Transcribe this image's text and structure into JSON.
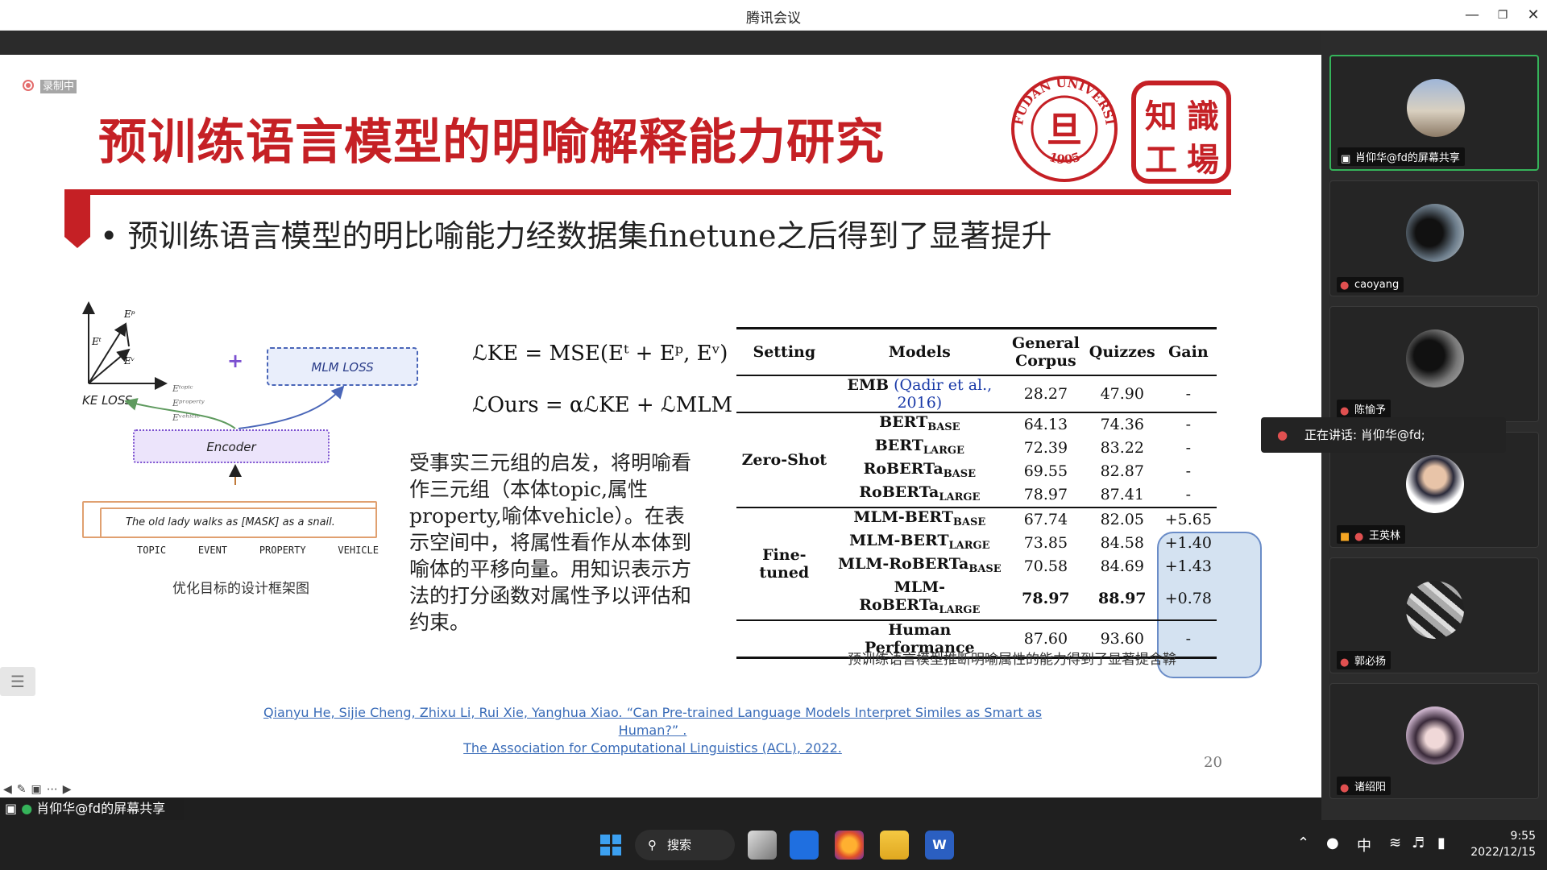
{
  "window": {
    "title": "腾讯会议"
  },
  "recording": {
    "label": "录制中"
  },
  "slide": {
    "title": "预训练语言模型的明喻解释能力研究",
    "bullet": "预训练语言模型的明比喻能力经数据集finetune之后得到了显著提升",
    "logo_fudan": {
      "top": "FUDAN UNIVERSITY",
      "year": "1905"
    },
    "logo_zhishi": [
      "知",
      "識",
      "工",
      "場"
    ],
    "diagram": {
      "ep": "Eᵖ",
      "et": "Eᵗ",
      "ev": "Eᵛ",
      "ke_loss": "KE LOSS",
      "mlm_loss": "MLM LOSS",
      "plus": "+",
      "e_topic": "Eᵗᵒᵖⁱᶜ",
      "e_property": "Eᵖʳᵒᵖᵉʳᵗʸ",
      "e_vehicle": "Eᵛᵉʰⁱᶜˡᵉ",
      "encoder": "Encoder",
      "sentence": "The old lady walks as [MASK] as a snail.",
      "labels": [
        "TOPIC",
        "EVENT",
        "PROPERTY",
        "VEHICLE"
      ]
    },
    "caption_left": "优化目标的设计框架图",
    "formula1": "ℒKE = MSE(Eᵗ + Eᵖ, Eᵛ)",
    "formula2": "ℒOurs = αℒKE + ℒMLM",
    "paragraph": "受事实三元组的启发，将明喻看作三元组（本体topic,属性property,喻体vehicle）。在表示空间中，将属性看作从本体到喻体的平移向量。用知识表示方法的打分函数对属性予以评估和约束。",
    "table": {
      "headers": [
        "Setting",
        "Models",
        "General Corpus",
        "Quizzes",
        "Gain"
      ],
      "emb": {
        "model": "EMB",
        "cite": "(Qadir et al., 2016)",
        "general": "28.27",
        "quizzes": "47.90",
        "gain": "-"
      },
      "zero_shot": {
        "label": "Zero-Shot",
        "rows": [
          {
            "model": "BERT",
            "sub": "BASE",
            "general": "64.13",
            "quizzes": "74.36",
            "gain": "-"
          },
          {
            "model": "BERT",
            "sub": "LARGE",
            "general": "72.39",
            "quizzes": "83.22",
            "gain": "-"
          },
          {
            "model": "RoBERTa",
            "sub": "BASE",
            "general": "69.55",
            "quizzes": "82.87",
            "gain": "-"
          },
          {
            "model": "RoBERTa",
            "sub": "LARGE",
            "general": "78.97",
            "quizzes": "87.41",
            "gain": "-"
          }
        ]
      },
      "fine_tuned": {
        "label": "Fine-tuned",
        "rows": [
          {
            "model": "MLM-BERT",
            "sub": "BASE",
            "general": "67.74",
            "quizzes": "82.05",
            "gain": "+5.65"
          },
          {
            "model": "MLM-BERT",
            "sub": "LARGE",
            "general": "73.85",
            "quizzes": "84.58",
            "gain": "+1.40"
          },
          {
            "model": "MLM-RoBERTa",
            "sub": "BASE",
            "general": "70.58",
            "quizzes": "84.69",
            "gain": "+1.43"
          },
          {
            "model": "MLM-RoBERTa",
            "sub": "LARGE",
            "general": "78.97",
            "quizzes": "88.97",
            "gain": "+0.78"
          }
        ]
      },
      "human": {
        "model": "Human Performance",
        "general": "87.60",
        "quizzes": "93.60",
        "gain": "-"
      }
    },
    "caption_right": "预训练语言模型推断明喻属性的能力得到了显著提舍鞥",
    "reference_line1": "Qianyu He, Sijie Cheng, Zhixu Li, Rui Xie, Yanghua Xiao. “Can Pre-trained Language Models Interpret Similes as Smart as Human?” .",
    "reference_line2": "The Association for Computational Linguistics (ACL), 2022.",
    "page_number": "20"
  },
  "share_bar": {
    "label": "肖仰华@fd的屏幕共享"
  },
  "participants": [
    {
      "name": "肖仰华@fd的屏幕共享",
      "icon": "screen-share-icon",
      "active": true
    },
    {
      "name": "caoyang",
      "icon": "mic-muted-icon",
      "active": false
    },
    {
      "name": "陈愉予",
      "icon": "mic-muted-icon",
      "active": false
    },
    {
      "name": "王英林",
      "icon": "mic-muted-icon",
      "active": false
    },
    {
      "name": "郭必扬",
      "icon": "mic-muted-icon",
      "active": false
    },
    {
      "name": "诸绍阳",
      "icon": "mic-muted-icon",
      "active": false
    }
  ],
  "speaking": {
    "label": "正在讲话: 肖仰华@fd;"
  },
  "taskbar": {
    "search_label": "搜索",
    "ime": "中",
    "time": "9:55",
    "date": "2022/12/15"
  },
  "colors": {
    "accent_red": "#c52025",
    "highlight_blue": "#a0bee1",
    "active_green": "#35b35a"
  }
}
